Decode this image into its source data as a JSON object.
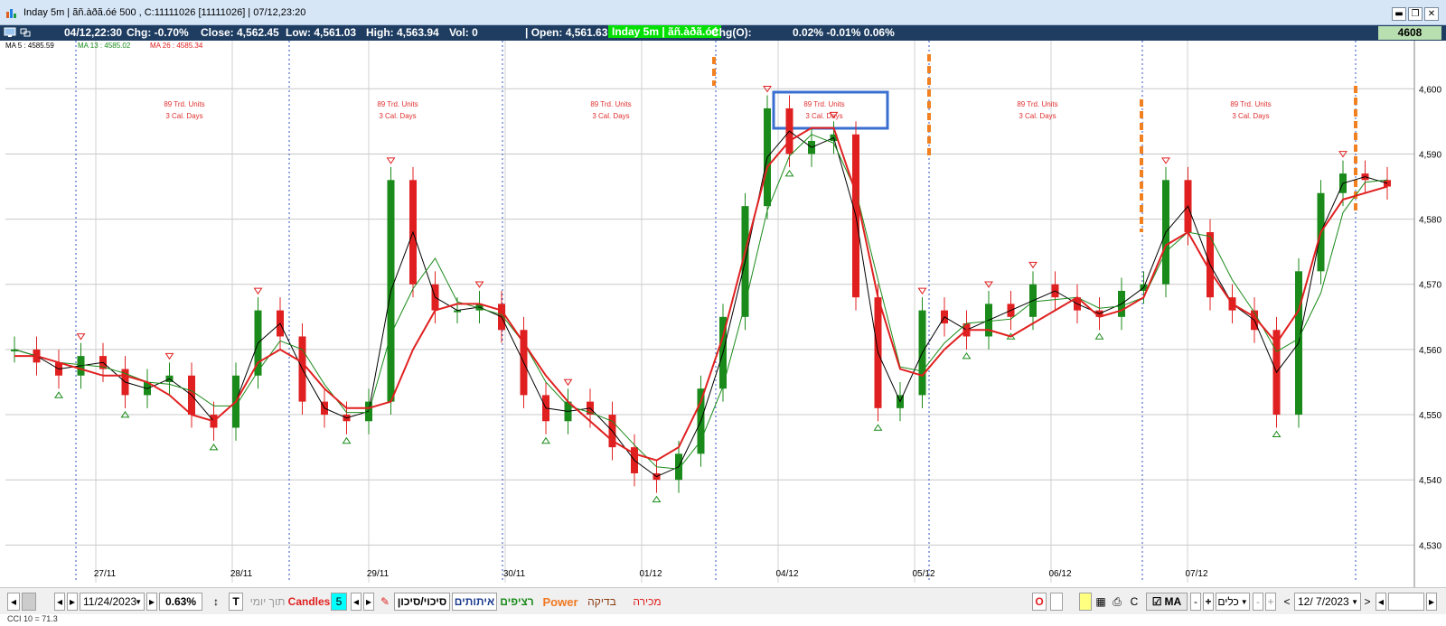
{
  "window": {
    "title": "Inday 5m | ãñ.àðã.óé 500 , C:11111026 [11111026] | 07/12,23:20",
    "minimize": "▬",
    "restore": "❐",
    "close": "✕"
  },
  "infobar": {
    "datetime": "04/12,22:30",
    "chg": "Chg: -0.70%",
    "close": "Close: 4,562.45",
    "low": "Low: 4,561.03",
    "high": "High: 4,563.94",
    "vol": "Vol: 0",
    "open": "| Open: 4,561.63",
    "tag": "Inday 5m | ãñ.àðã.óé",
    "chgo": "Chg(O):",
    "chgo_values": "0.02%  -0.01%  0.06%",
    "last_price": "4608"
  },
  "ma_legend": [
    {
      "label": "MA 5 : 4585.59",
      "color": "#000000"
    },
    {
      "label": "MA 13 : 4585.02",
      "color": "#1a8a1a"
    },
    {
      "label": "MA 26 : 4585.34",
      "color": "#e02020"
    }
  ],
  "chart_data": {
    "type": "candlestick",
    "y_ticks": [
      "4,600",
      "4,590",
      "4,580",
      "4,570",
      "4,560",
      "4,550",
      "4,540",
      "4,530"
    ],
    "ylim": [
      4527,
      4606
    ],
    "x_labels": [
      "27/11",
      "28/11",
      "29/11",
      "30/11",
      "01/12",
      "04/12",
      "05/12",
      "06/12",
      "07/12"
    ],
    "annotations": [
      {
        "line1": "89 Trd. Units",
        "line2": "3 Cal. Days"
      },
      {
        "line1": "89 Trd. Units",
        "line2": "3 Cal. Days"
      },
      {
        "line1": "89 Trd. Units",
        "line2": "3 Cal. Days"
      },
      {
        "line1": "89 Trd. Units",
        "line2": "3 Cal. Days"
      },
      {
        "line1": "89 Trd. Units",
        "line2": "3 Cal. Days"
      },
      {
        "line1": "89 Trd. Units",
        "line2": "3 Cal. Days"
      }
    ],
    "ma26_path_values": [
      4559,
      4559,
      4558,
      4557,
      4556,
      4556,
      4555,
      4553,
      4550,
      4549,
      4552,
      4558,
      4560,
      4558,
      4554,
      4551,
      4551,
      4552,
      4560,
      4566,
      4567,
      4567,
      4566,
      4561,
      4556,
      4552,
      4549,
      4546,
      4544,
      4543,
      4545,
      4552,
      4562,
      4575,
      4588,
      4592,
      4594,
      4594,
      4584,
      4568,
      4557,
      4556,
      4560,
      4563,
      4563,
      4562,
      4564,
      4566,
      4568,
      4565,
      4566,
      4568,
      4576,
      4578,
      4572,
      4567,
      4565,
      4561,
      4566,
      4578,
      4583,
      4584,
      4585
    ],
    "closes": [
      4560,
      4558,
      4556,
      4559,
      4557,
      4553,
      4555,
      4556,
      4550,
      4548,
      4556,
      4566,
      4562,
      4552,
      4550,
      4549,
      4552,
      4586,
      4570,
      4566,
      4566,
      4567,
      4563,
      4553,
      4549,
      4552,
      4550,
      4545,
      4541,
      4540,
      4544,
      4554,
      4565,
      4582,
      4597,
      4590,
      4592,
      4593,
      4568,
      4551,
      4553,
      4566,
      4564,
      4562,
      4567,
      4565,
      4570,
      4568,
      4566,
      4565,
      4569,
      4570,
      4586,
      4578,
      4568,
      4566,
      4563,
      4550,
      4572,
      4584,
      4587,
      4586,
      4585
    ]
  },
  "toolbar": {
    "date_value": "11/24/2023",
    "percent_value": "0.63%",
    "tool_t": "T",
    "intraday_label": "תוך יומי",
    "candles_label": "Candles",
    "candles_count": "5",
    "risk_label": "סיכוי/סיכון",
    "signals_label": "איתותים",
    "continuous_label": "רציפים",
    "power_label": "Power",
    "test_label": "בדיקה",
    "sell_label": "מכירה",
    "o_label": "O",
    "c_label": "C",
    "ma_label": "MA",
    "minus_label": "-",
    "plus_label": "+",
    "tools_label": "כלים",
    "end_date_value": "12/ 7/2023"
  },
  "status": {
    "cci": "CCI 10 = 71.3"
  }
}
